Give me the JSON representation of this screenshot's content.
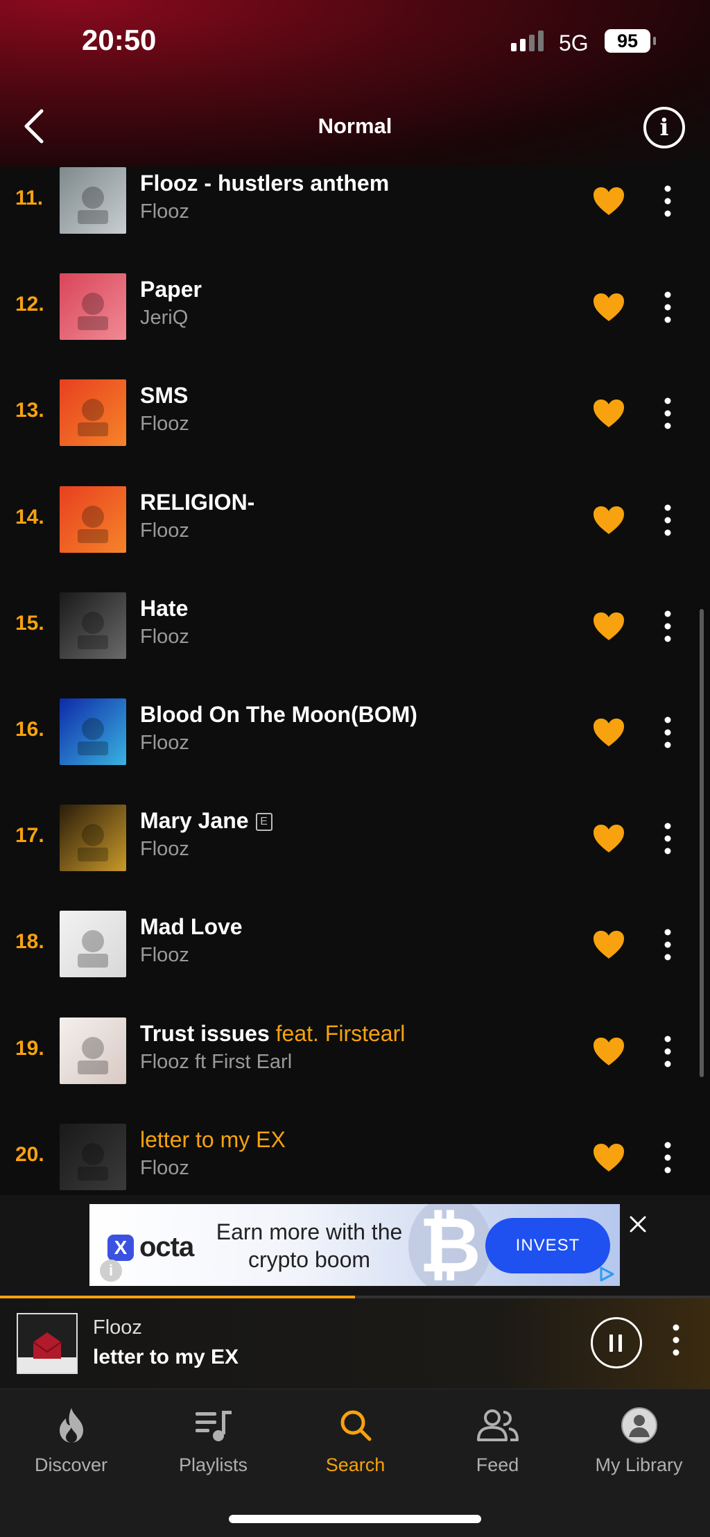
{
  "status_bar": {
    "time": "20:50",
    "network": "5G",
    "battery": "95"
  },
  "header": {
    "title": "Normal"
  },
  "tracks": [
    {
      "num": "11.",
      "title": "Flooz -  hustlers anthem",
      "feat": "",
      "artist": "Flooz",
      "explicit": false,
      "playing": false,
      "art_colors": [
        "#7f8a8c",
        "#c8cdd0"
      ]
    },
    {
      "num": "12.",
      "title": "Paper",
      "feat": "",
      "artist": "JeriQ",
      "explicit": false,
      "playing": false,
      "art_colors": [
        "#d9455a",
        "#f08a94"
      ]
    },
    {
      "num": "13.",
      "title": "SMS",
      "feat": "",
      "artist": "Flooz",
      "explicit": false,
      "playing": false,
      "art_colors": [
        "#e8401f",
        "#f6842a"
      ]
    },
    {
      "num": "14.",
      "title": "RELIGION-",
      "feat": "",
      "artist": "Flooz",
      "explicit": false,
      "playing": false,
      "art_colors": [
        "#e8401f",
        "#f6842a"
      ]
    },
    {
      "num": "15.",
      "title": "Hate",
      "feat": "",
      "artist": "Flooz",
      "explicit": false,
      "playing": false,
      "art_colors": [
        "#1a1a1a",
        "#6a6a6a"
      ]
    },
    {
      "num": "16.",
      "title": "Blood On The Moon(BOM)",
      "feat": "",
      "artist": "Flooz",
      "explicit": false,
      "playing": false,
      "art_colors": [
        "#0f2aa8",
        "#39b3e0"
      ]
    },
    {
      "num": "17.",
      "title": "Mary Jane",
      "feat": "",
      "artist": "Flooz",
      "explicit": true,
      "playing": false,
      "art_colors": [
        "#2a1c0a",
        "#c99a2a"
      ]
    },
    {
      "num": "18.",
      "title": "Mad Love",
      "feat": "",
      "artist": "Flooz",
      "explicit": false,
      "playing": false,
      "art_colors": [
        "#f2f2f2",
        "#d8d8d8"
      ]
    },
    {
      "num": "19.",
      "title": "Trust issues",
      "feat": "feat. Firstearl",
      "artist": "Flooz ft First Earl",
      "explicit": false,
      "playing": false,
      "art_colors": [
        "#f4f0ec",
        "#d8c9c4"
      ]
    },
    {
      "num": "20.",
      "title": "letter to my EX",
      "feat": "",
      "artist": "Flooz",
      "explicit": false,
      "playing": true,
      "art_colors": [
        "#1a1a1a",
        "#3a3a3a"
      ]
    }
  ],
  "explicit_badge": "E",
  "ad": {
    "brand": "octa",
    "brand_mark": "X",
    "headline": "Earn more with the crypto boom",
    "button": "INVEST",
    "coin_symbol": "₿",
    "info": "i"
  },
  "player": {
    "artist": "Flooz",
    "track": "letter to my EX",
    "progress": 0.5
  },
  "tabs": [
    {
      "label": "Discover",
      "icon": "flame-icon",
      "active": false
    },
    {
      "label": "Playlists",
      "icon": "playlist-icon",
      "active": false
    },
    {
      "label": "Search",
      "icon": "search-icon",
      "active": true
    },
    {
      "label": "Feed",
      "icon": "people-icon",
      "active": false
    },
    {
      "label": "My Library",
      "icon": "avatar",
      "active": false
    }
  ],
  "colors": {
    "accent": "#f7a20e",
    "background": "#0d0d0d",
    "muted_text": "#9a9a9a"
  }
}
